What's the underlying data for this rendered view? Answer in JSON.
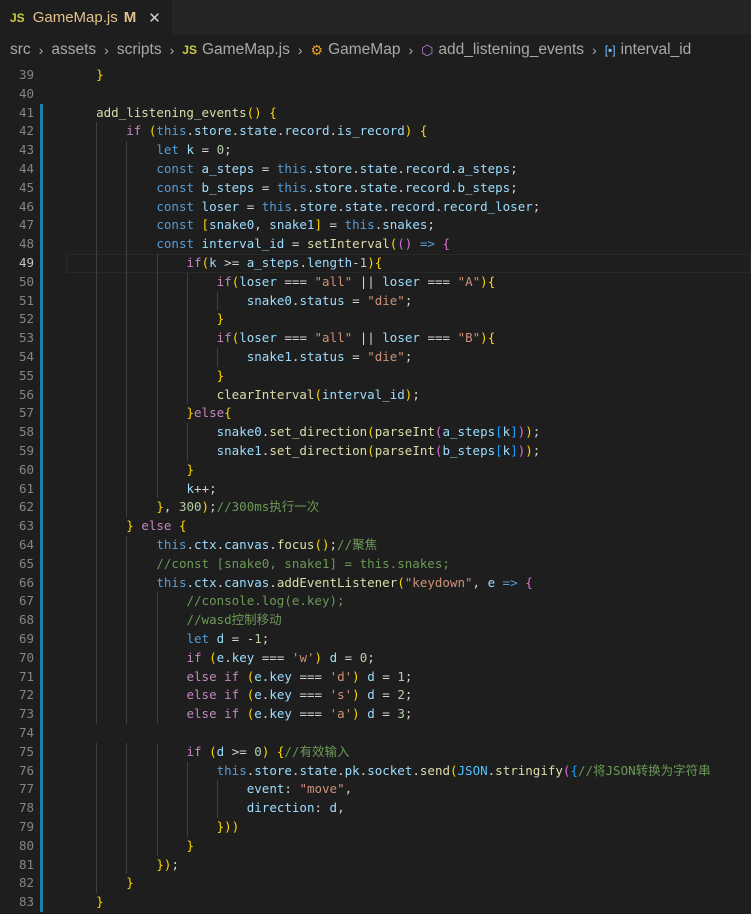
{
  "tab": {
    "icon": "js-file-icon",
    "badge": "JS",
    "filename": "GameMap.js",
    "modified": "M",
    "close": "✕"
  },
  "breadcrumb": {
    "items": [
      {
        "label": "src",
        "icon": ""
      },
      {
        "label": "assets",
        "icon": ""
      },
      {
        "label": "scripts",
        "icon": ""
      },
      {
        "label": "GameMap.js",
        "icon": "js-file-icon"
      },
      {
        "label": "GameMap",
        "icon": "class-icon"
      },
      {
        "label": "add_listening_events",
        "icon": "method-icon"
      },
      {
        "label": "interval_id",
        "icon": "variable-icon"
      }
    ]
  },
  "colors": {
    "background": "#1e1e1e",
    "keyword": "#569cd6",
    "control": "#c586c0",
    "variable": "#9cdcfe",
    "constant": "#4fc1ff",
    "function": "#dcdcaa",
    "string": "#ce9178",
    "number": "#b5cea8",
    "comment": "#6a9955"
  },
  "active_line": 49,
  "lines": [
    {
      "n": 39,
      "code": "    }"
    },
    {
      "n": 40,
      "code": ""
    },
    {
      "n": 41,
      "code": "    add_listening_events() {"
    },
    {
      "n": 42,
      "code": "        if (this.store.state.record.is_record) {"
    },
    {
      "n": 43,
      "code": "            let k = 0;"
    },
    {
      "n": 44,
      "code": "            const a_steps = this.store.state.record.a_steps;"
    },
    {
      "n": 45,
      "code": "            const b_steps = this.store.state.record.b_steps;"
    },
    {
      "n": 46,
      "code": "            const loser = this.store.state.record.record_loser;"
    },
    {
      "n": 47,
      "code": "            const [snake0, snake1] = this.snakes;"
    },
    {
      "n": 48,
      "code": "            const interval_id = setInterval(() => {"
    },
    {
      "n": 49,
      "code": "                if(k >= a_steps.length-1){"
    },
    {
      "n": 50,
      "code": "                    if(loser === \"all\" || loser === \"A\"){"
    },
    {
      "n": 51,
      "code": "                        snake0.status = \"die\";"
    },
    {
      "n": 52,
      "code": "                    }"
    },
    {
      "n": 53,
      "code": "                    if(loser === \"all\" || loser === \"B\"){"
    },
    {
      "n": 54,
      "code": "                        snake1.status = \"die\";"
    },
    {
      "n": 55,
      "code": "                    }"
    },
    {
      "n": 56,
      "code": "                    clearInterval(interval_id);"
    },
    {
      "n": 57,
      "code": "                }else{"
    },
    {
      "n": 58,
      "code": "                    snake0.set_direction(parseInt(a_steps[k]));"
    },
    {
      "n": 59,
      "code": "                    snake1.set_direction(parseInt(b_steps[k]));"
    },
    {
      "n": 60,
      "code": "                }"
    },
    {
      "n": 61,
      "code": "                k++;"
    },
    {
      "n": 62,
      "code": "            }, 300);//300ms执行一次"
    },
    {
      "n": 63,
      "code": "        } else {"
    },
    {
      "n": 64,
      "code": "            this.ctx.canvas.focus();//聚焦"
    },
    {
      "n": 65,
      "code": "            //const [snake0, snake1] = this.snakes;"
    },
    {
      "n": 66,
      "code": "            this.ctx.canvas.addEventListener(\"keydown\", e => {"
    },
    {
      "n": 67,
      "code": "                //console.log(e.key);"
    },
    {
      "n": 68,
      "code": "                //wasd控制移动"
    },
    {
      "n": 69,
      "code": "                let d = -1;"
    },
    {
      "n": 70,
      "code": "                if (e.key === 'w') d = 0;"
    },
    {
      "n": 71,
      "code": "                else if (e.key === 'd') d = 1;"
    },
    {
      "n": 72,
      "code": "                else if (e.key === 's') d = 2;"
    },
    {
      "n": 73,
      "code": "                else if (e.key === 'a') d = 3;"
    },
    {
      "n": 74,
      "code": ""
    },
    {
      "n": 75,
      "code": "                if (d >= 0) {//有效输入"
    },
    {
      "n": 76,
      "code": "                    this.store.state.pk.socket.send(JSON.stringify({//将JSON转换为字符串"
    },
    {
      "n": 77,
      "code": "                        event: \"move\","
    },
    {
      "n": 78,
      "code": "                        direction: d,"
    },
    {
      "n": 79,
      "code": "                    }))"
    },
    {
      "n": 80,
      "code": "                }"
    },
    {
      "n": 81,
      "code": "            });"
    },
    {
      "n": 82,
      "code": "        }"
    },
    {
      "n": 83,
      "code": "    }"
    }
  ]
}
